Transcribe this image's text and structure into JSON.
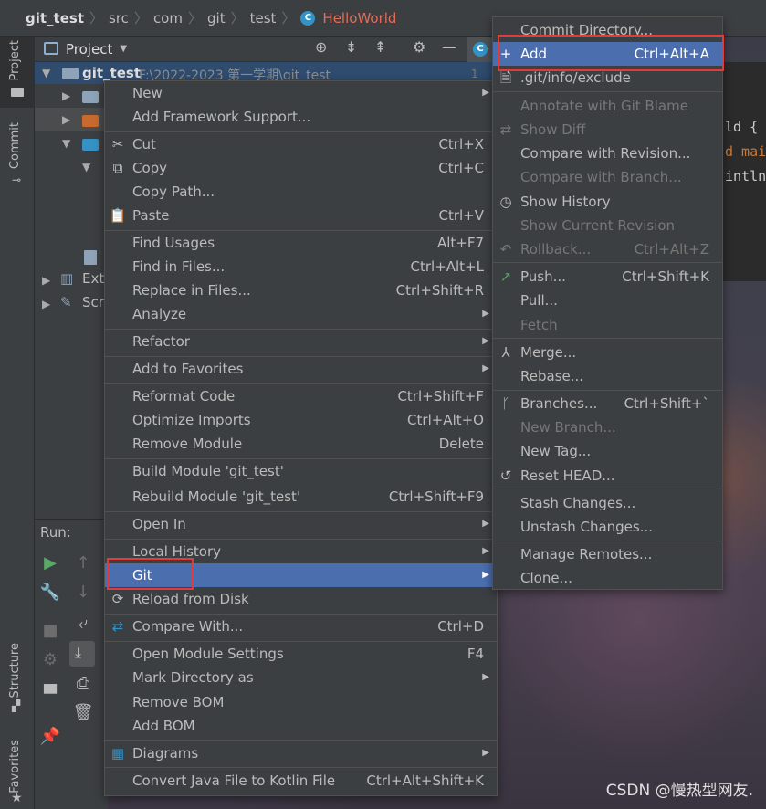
{
  "breadcrumb": [
    "git_test",
    "src",
    "com",
    "git",
    "test",
    "HelloWorld"
  ],
  "leftStripe": {
    "project": "Project",
    "commit": "Commit",
    "structure": "Structure",
    "favorites": "Favorites"
  },
  "projectPanel": {
    "title": "Project",
    "rootName": "git_test",
    "rootPath": "F:\\2022-2023 第一学期\\git_test",
    "extLibs": "Exte",
    "scratches": "Scr"
  },
  "editor": {
    "lineNumber": "1",
    "lines": [
      "ld {",
      "d mai",
      "intln"
    ]
  },
  "runPanel": {
    "label": "Run:"
  },
  "contextMenu": {
    "new": "New",
    "addFramework": "Add Framework Support...",
    "cut": "Cut",
    "cutShortcut": "Ctrl+X",
    "copy": "Copy",
    "copyShortcut": "Ctrl+C",
    "copyPath": "Copy Path...",
    "paste": "Paste",
    "pasteShortcut": "Ctrl+V",
    "findUsages": "Find Usages",
    "findUsagesShortcut": "Alt+F7",
    "findInFiles": "Find in Files...",
    "findInFilesShortcut": "Ctrl+Alt+L",
    "replaceInFiles": "Replace in Files...",
    "replaceInFilesShortcut": "Ctrl+Shift+R",
    "analyze": "Analyze",
    "refactor": "Refactor",
    "addToFavorites": "Add to Favorites",
    "reformatCode": "Reformat Code",
    "reformatCodeShortcut": "Ctrl+Shift+F",
    "optimizeImports": "Optimize Imports",
    "optimizeImportsShortcut": "Ctrl+Alt+O",
    "removeModule": "Remove Module",
    "removeModuleShortcut": "Delete",
    "buildModule": "Build Module 'git_test'",
    "rebuildModule": "Rebuild Module 'git_test'",
    "rebuildModuleShortcut": "Ctrl+Shift+F9",
    "openIn": "Open In",
    "localHistory": "Local History",
    "git": "Git",
    "reloadFromDisk": "Reload from Disk",
    "compareWith": "Compare With...",
    "compareWithShortcut": "Ctrl+D",
    "openModuleSettings": "Open Module Settings",
    "openModuleSettingsShortcut": "F4",
    "markDirectoryAs": "Mark Directory as",
    "removeBom": "Remove BOM",
    "addBom": "Add BOM",
    "diagrams": "Diagrams",
    "convertJavaToKotlin": "Convert Java File to Kotlin File",
    "convertJavaToKotlinShortcut": "Ctrl+Alt+Shift+K"
  },
  "gitMenu": {
    "commitDirectory": "Commit Directory...",
    "add": "Add",
    "addShortcut": "Ctrl+Alt+A",
    "exclude": ".git/info/exclude",
    "annotate": "Annotate with Git Blame",
    "showDiff": "Show Diff",
    "compareWithRevision": "Compare with Revision...",
    "compareWithBranch": "Compare with Branch...",
    "showHistory": "Show History",
    "showCurrentRevision": "Show Current Revision",
    "rollback": "Rollback...",
    "rollbackShortcut": "Ctrl+Alt+Z",
    "push": "Push...",
    "pushShortcut": "Ctrl+Shift+K",
    "pull": "Pull...",
    "fetch": "Fetch",
    "merge": "Merge...",
    "rebase": "Rebase...",
    "branches": "Branches...",
    "branchesShortcut": "Ctrl+Shift+`",
    "newBranch": "New Branch...",
    "newTag": "New Tag...",
    "resetHead": "Reset HEAD...",
    "stashChanges": "Stash Changes...",
    "unstashChanges": "Unstash Changes...",
    "manageRemotes": "Manage Remotes...",
    "clone": "Clone..."
  },
  "watermark": "CSDN @慢热型网友.",
  "colors": {
    "selection": "#4b6eaf",
    "highlight": "#e33b3b",
    "menuBg": "#3c3f41",
    "className": "#e06c5a"
  }
}
